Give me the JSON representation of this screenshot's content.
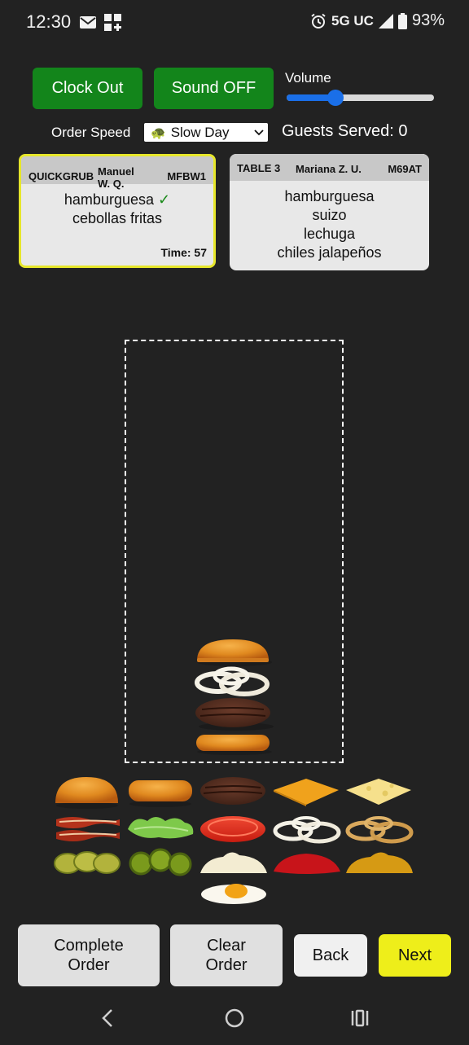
{
  "status_bar": {
    "time": "12:30",
    "network": "5G UC",
    "battery": "93%",
    "icons": [
      "mail-icon",
      "widgets-icon",
      "alarm-icon",
      "signal-icon",
      "battery-icon"
    ]
  },
  "controls": {
    "clock_out_label": "Clock Out",
    "sound_label": "Sound OFF",
    "volume_label": "Volume",
    "volume_level": 0.33,
    "order_speed_label": "Order Speed",
    "order_speed_icon": "🐢",
    "order_speed_value": "Slow Day",
    "guests_served": "Guests Served: 0"
  },
  "tickets": [
    {
      "source": "QUICKGRUB",
      "customer": "Manuel W. Q.",
      "code": "MFBW1",
      "items": [
        "hamburguesa",
        "cebollas fritas"
      ],
      "check_mark": "✓",
      "time": "Time: 57",
      "selected": true
    },
    {
      "source": "TABLE 3",
      "customer": "Mariana Z. U.",
      "code": "M69AT",
      "items": [
        "hamburguesa",
        "suizo",
        "lechuga",
        "chiles jalapeños"
      ],
      "selected": false
    }
  ],
  "burger_stack": [
    "top-bun",
    "onion-rings",
    "beef-patty",
    "bottom-bun"
  ],
  "ingredient_palette": [
    "top-bun",
    "bottom-bun",
    "beef-patty",
    "cheddar-cheese",
    "swiss-cheese",
    "bacon",
    "lettuce",
    "tomato",
    "onion-rings",
    "fried-onions",
    "pickles",
    "jalapenos",
    "mayo",
    "ketchup",
    "mustard",
    "fried-egg"
  ],
  "actions": {
    "complete_line1": "Complete",
    "complete_line2": "Order",
    "clear_line1": "Clear",
    "clear_line2": "Order",
    "back": "Back",
    "next": "Next"
  },
  "navigation": [
    "back-icon",
    "home-icon",
    "recents-icon"
  ]
}
